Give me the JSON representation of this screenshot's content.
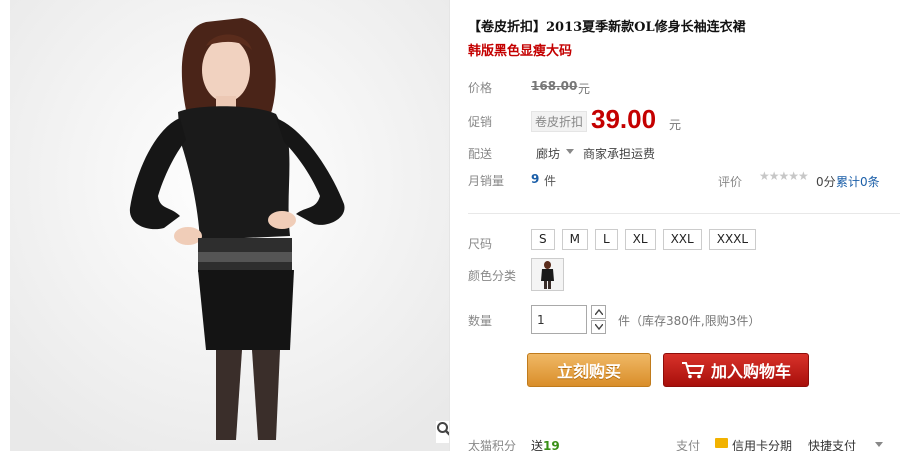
{
  "product": {
    "title": "【卷皮折扣】2013夏季新款OL修身长袖连衣裙",
    "subtitle": "韩版黑色显瘦大码"
  },
  "price": {
    "label": "价格",
    "original": "168.00",
    "unit": "元"
  },
  "promo": {
    "label": "促销",
    "tag": "卷皮折扣",
    "price": "39.00",
    "unit": "元"
  },
  "shipping": {
    "label": "配送",
    "from": "廊坊",
    "fee": "商家承担运费"
  },
  "sales": {
    "label": "月销量",
    "count": "9",
    "unit": "件"
  },
  "rating": {
    "label": "评价",
    "stars": "★★★★★",
    "score": "0分",
    "reviews": "累计0条"
  },
  "options": {
    "size_label": "尺码",
    "sizes": [
      "S",
      "M",
      "L",
      "XL",
      "XXL",
      "XXXL"
    ],
    "color_label": "颜色分类"
  },
  "quantity": {
    "label": "数量",
    "value": "1",
    "stock": "件（库存380件,限购3件）"
  },
  "actions": {
    "buy_now": "立刻购买",
    "add_to_cart": "加入购物车"
  },
  "footer": {
    "points_label": "太猫积分",
    "points_prefix": "送",
    "points_value": "19",
    "pay_label": "支付",
    "card_pay": "信用卡分期",
    "quick_pay": "快捷支付"
  },
  "icons": {
    "zoom": "magnifier-icon",
    "cart": "shopping-cart-icon"
  },
  "colors": {
    "accent_red": "#c40000",
    "buy_orange": "#e0a040",
    "cart_red": "#c21b14",
    "link_blue": "#1a5ea8"
  }
}
